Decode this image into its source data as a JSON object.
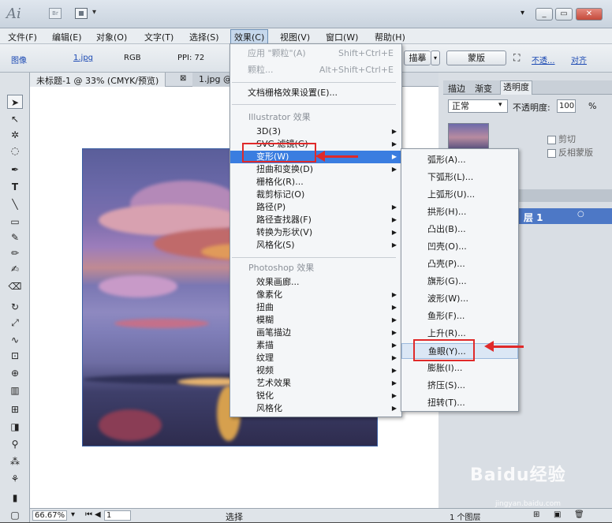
{
  "app": {
    "logo": "Ai",
    "br_label": "Br"
  },
  "window": {
    "minimize": "_",
    "restore": "▭",
    "close": "✕"
  },
  "menubar": [
    "文件(F)",
    "编辑(E)",
    "对象(O)",
    "文字(T)",
    "选择(S)",
    "效果(C)",
    "视图(V)",
    "窗口(W)",
    "帮助(H)"
  ],
  "control": {
    "label_image": "图像",
    "filename": "1.jpg",
    "mode": "RGB",
    "ppi": "PPI: 72",
    "btn_partial": "描摹",
    "btn_mask": "蒙版",
    "opacity_link": "不透...",
    "align_link": "对齐"
  },
  "doc_tabs": [
    "未标题-1 @ 33% (CMYK/预览)",
    "1.jpg @"
  ],
  "status": {
    "zoom": "66.67%",
    "page": "1",
    "tool": "选择"
  },
  "panel": {
    "tabs": [
      "描边",
      "渐变",
      "透明度"
    ],
    "blend_mode": "正常",
    "opacity_label": "不透明度:",
    "opacity_value": "100",
    "opacity_unit": "%",
    "clip_label": "剪切",
    "invert_label": "反相蒙版",
    "layer_name": "层 1",
    "layer_count": "1 个图层"
  },
  "effects_menu": {
    "top": [
      {
        "label": "应用 \"颗粒\"(A)",
        "shortcut": "Shift+Ctrl+E",
        "disabled": true
      },
      {
        "label": "颗粒...",
        "shortcut": "Alt+Shift+Ctrl+E",
        "disabled": true
      }
    ],
    "doc_settings": "文档栅格效果设置(E)...",
    "illustrator_header": "Illustrator 效果",
    "illustrator": [
      "3D(3)",
      "SVG 滤镜(G)",
      "变形(W)",
      "扭曲和变换(D)",
      "栅格化(R)...",
      "裁剪标记(O)",
      "路径(P)",
      "路径查找器(F)",
      "转换为形状(V)",
      "风格化(S)"
    ],
    "illustrator_submenu": [
      true,
      true,
      true,
      true,
      false,
      false,
      true,
      true,
      true,
      true
    ],
    "photoshop_header": "Photoshop 效果",
    "photoshop": [
      "效果画廊...",
      "像素化",
      "扭曲",
      "模糊",
      "画笔描边",
      "素描",
      "纹理",
      "视频",
      "艺术效果",
      "锐化",
      "风格化"
    ],
    "photoshop_submenu": [
      false,
      true,
      true,
      true,
      true,
      true,
      true,
      true,
      true,
      true,
      true
    ]
  },
  "warp_submenu": [
    "弧形(A)...",
    "下弧形(L)...",
    "上弧形(U)...",
    "拱形(H)...",
    "凸出(B)...",
    "凹壳(O)...",
    "凸壳(P)...",
    "旗形(G)...",
    "波形(W)...",
    "鱼形(F)...",
    "上升(R)...",
    "鱼眼(Y)...",
    "膨胀(I)...",
    "挤压(S)...",
    "扭转(T)..."
  ],
  "watermark": {
    "brand": "Baidu经验",
    "url": "jingyan.baidu.com"
  },
  "colors": {
    "highlight": "#3a7de0",
    "annotation": "#e02a2a"
  }
}
